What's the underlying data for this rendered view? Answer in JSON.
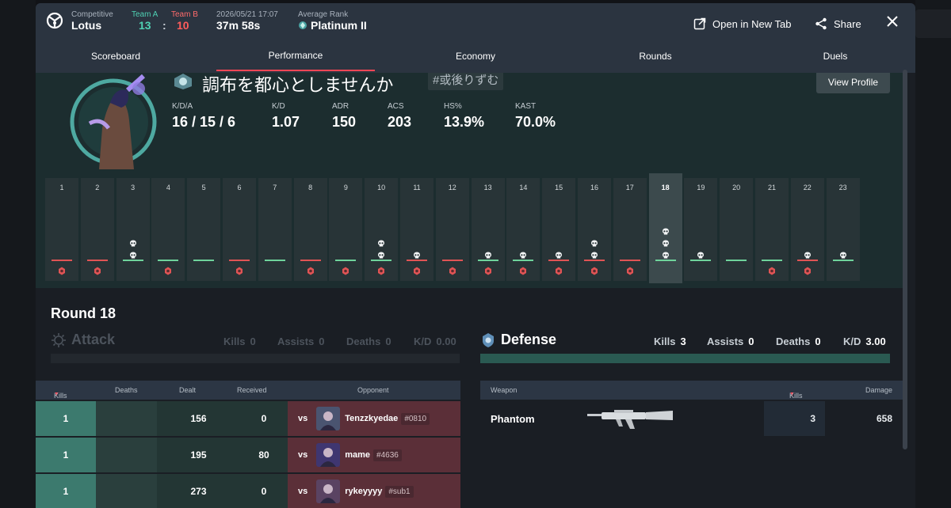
{
  "match": {
    "mode": "Competitive",
    "map": "Lotus",
    "team_a_label": "Team A",
    "team_b_label": "Team B",
    "team_a_score": "13",
    "separator": ":",
    "team_b_score": "10",
    "date": "2026/05/21 17:07",
    "duration": "37m 58s",
    "avg_rank_label": "Average Rank",
    "avg_rank": "Platinum II"
  },
  "header_actions": {
    "open_new_tab": "Open in New Tab",
    "share": "Share"
  },
  "tabs": [
    "Scoreboard",
    "Performance",
    "Economy",
    "Rounds",
    "Duels"
  ],
  "active_tab": "Performance",
  "player": {
    "name": "調布を都心としませんか",
    "tag": "#或後りずむ",
    "view_profile": "View Profile",
    "stats": [
      {
        "label": "K/D/A",
        "value": "16 / 15 / 6"
      },
      {
        "label": "K/D",
        "value": "1.07"
      },
      {
        "label": "ADR",
        "value": "150"
      },
      {
        "label": "ACS",
        "value": "203"
      },
      {
        "label": "HS%",
        "value": "13.9%"
      },
      {
        "label": "KAST",
        "value": "70.0%"
      }
    ]
  },
  "rounds": [
    {
      "n": "1",
      "kills": 0,
      "result": "loss",
      "spike": true
    },
    {
      "n": "2",
      "kills": 0,
      "result": "loss",
      "spike": true
    },
    {
      "n": "3",
      "kills": 2,
      "result": "win",
      "spike": false
    },
    {
      "n": "4",
      "kills": 0,
      "result": "win",
      "spike": true
    },
    {
      "n": "5",
      "kills": 0,
      "result": "win",
      "spike": false
    },
    {
      "n": "6",
      "kills": 0,
      "result": "loss",
      "spike": true
    },
    {
      "n": "7",
      "kills": 0,
      "result": "win",
      "spike": false
    },
    {
      "n": "8",
      "kills": 0,
      "result": "loss",
      "spike": true
    },
    {
      "n": "9",
      "kills": 0,
      "result": "win",
      "spike": true
    },
    {
      "n": "10",
      "kills": 2,
      "result": "win",
      "spike": true
    },
    {
      "n": "11",
      "kills": 1,
      "result": "loss",
      "spike": true
    },
    {
      "n": "12",
      "kills": 0,
      "result": "loss",
      "spike": true
    },
    {
      "n": "13",
      "kills": 1,
      "result": "win",
      "spike": true
    },
    {
      "n": "14",
      "kills": 1,
      "result": "win",
      "spike": true
    },
    {
      "n": "15",
      "kills": 1,
      "result": "loss",
      "spike": true
    },
    {
      "n": "16",
      "kills": 2,
      "result": "loss",
      "spike": true
    },
    {
      "n": "17",
      "kills": 0,
      "result": "loss",
      "spike": true
    },
    {
      "n": "18",
      "kills": 3,
      "result": "win",
      "spike": false,
      "selected": true
    },
    {
      "n": "19",
      "kills": 1,
      "result": "win",
      "spike": false
    },
    {
      "n": "20",
      "kills": 0,
      "result": "win",
      "spike": false
    },
    {
      "n": "21",
      "kills": 0,
      "result": "win",
      "spike": true
    },
    {
      "n": "22",
      "kills": 1,
      "result": "loss",
      "spike": true
    },
    {
      "n": "23",
      "kills": 1,
      "result": "win",
      "spike": false
    }
  ],
  "round_title": "Round 18",
  "attack": {
    "title": "Attack",
    "kills_label": "Kills",
    "kills": "0",
    "assists_label": "Assists",
    "assists": "0",
    "deaths_label": "Deaths",
    "deaths": "0",
    "kd_label": "K/D",
    "kd": "0.00"
  },
  "defense": {
    "title": "Defense",
    "kills_label": "Kills",
    "kills": "3",
    "assists_label": "Assists",
    "assists": "0",
    "deaths_label": "Deaths",
    "deaths": "0",
    "kd_label": "K/D",
    "kd": "3.00"
  },
  "kills_table": {
    "headers": [
      "Kills",
      "Deaths",
      "Dealt",
      "Received",
      "Opponent"
    ],
    "vs_label": "vs",
    "rows": [
      {
        "kills": "1",
        "deaths": "",
        "dealt": "156",
        "received": "0",
        "opponent": "Tenzzkyedae",
        "tag": "#0810"
      },
      {
        "kills": "1",
        "deaths": "",
        "dealt": "195",
        "received": "80",
        "opponent": "mame",
        "tag": "#4636"
      },
      {
        "kills": "1",
        "deaths": "",
        "dealt": "273",
        "received": "0",
        "opponent": "rykeyyyy",
        "tag": "#sub1"
      }
    ]
  },
  "weapon_table": {
    "headers": [
      "Weapon",
      "Kills",
      "Damage"
    ],
    "rows": [
      {
        "weapon": "Phantom",
        "kills": "3",
        "damage": "658"
      }
    ]
  },
  "colors": {
    "team_a": "#4fd1b3",
    "team_b": "#ff5c5c",
    "accent": "#ff4655",
    "win": "#6fd39b",
    "loss": "#e05455"
  }
}
